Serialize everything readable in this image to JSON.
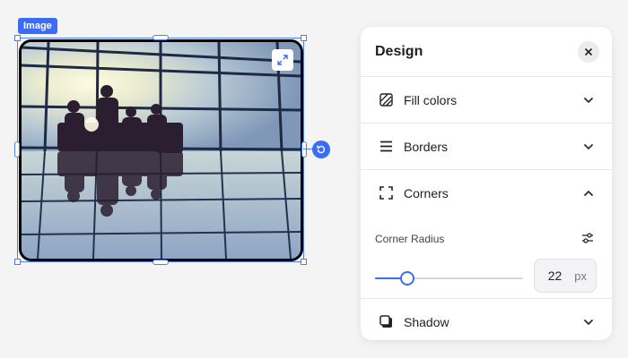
{
  "canvas": {
    "element_tag": "Image",
    "image_icons": {
      "expand": "expand-icon",
      "rotate": "rotate-icon"
    }
  },
  "panel": {
    "title": "Design",
    "close_icon": "close-icon",
    "sections": [
      {
        "label": "Fill colors",
        "icon": "fill-colors-icon",
        "expanded": false
      },
      {
        "label": "Borders",
        "icon": "borders-icon",
        "expanded": false
      },
      {
        "label": "Corners",
        "icon": "corners-icon",
        "expanded": true
      },
      {
        "label": "Shadow",
        "icon": "shadow-icon",
        "expanded": false
      }
    ],
    "corners": {
      "radius_label": "Corner Radius",
      "value": "22",
      "unit": "px",
      "slider_fraction": 0.22
    }
  },
  "colors": {
    "accent": "#3b6cf5",
    "panel_bg": "#ffffff",
    "canvas_bg": "#f4f4f5"
  }
}
